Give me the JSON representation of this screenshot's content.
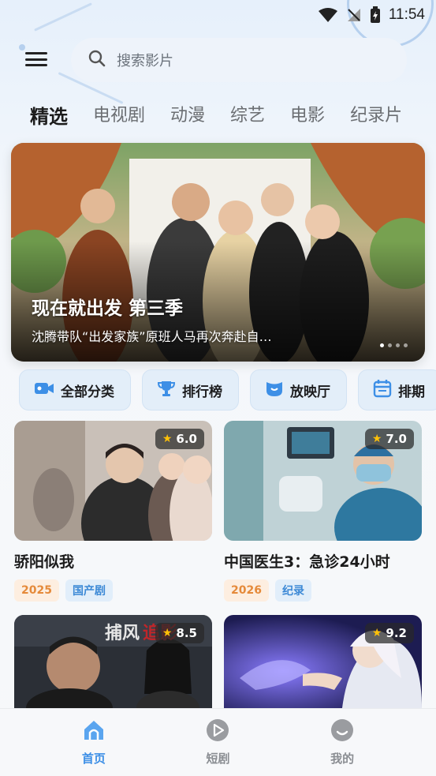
{
  "status_bar": {
    "time": "11:54"
  },
  "search": {
    "placeholder": "搜索影片"
  },
  "tabs": [
    {
      "label": "精选",
      "active": true
    },
    {
      "label": "电视剧",
      "active": false
    },
    {
      "label": "动漫",
      "active": false
    },
    {
      "label": "综艺",
      "active": false
    },
    {
      "label": "电影",
      "active": false
    },
    {
      "label": "纪录片",
      "active": false
    }
  ],
  "banner": {
    "title": "现在就出发 第三季",
    "subtitle": "沈腾带队“出发家族”原班人马再次奔赴自…"
  },
  "quick_actions": [
    {
      "label": "全部分类",
      "icon": "video-camera-icon"
    },
    {
      "label": "排行榜",
      "icon": "trophy-icon"
    },
    {
      "label": "放映厅",
      "icon": "theater-icon"
    },
    {
      "label": "排期",
      "icon": "calendar-icon"
    }
  ],
  "cards": [
    {
      "title": "骄阳似我",
      "rating": "6.0",
      "year": "2025",
      "genre": "国产剧"
    },
    {
      "title": "中国医生3：急诊24小时",
      "rating": "7.0",
      "year": "2026",
      "genre": "纪录"
    },
    {
      "title": "",
      "rating": "8.5",
      "year": "",
      "genre": ""
    },
    {
      "title": "",
      "rating": "9.2",
      "year": "",
      "genre": ""
    }
  ],
  "bottom_nav": [
    {
      "label": "首页",
      "icon": "home-icon",
      "active": true
    },
    {
      "label": "短剧",
      "icon": "play-circle-icon",
      "active": false
    },
    {
      "label": "我的",
      "icon": "smile-icon",
      "active": false
    }
  ],
  "colors": {
    "accent": "#3d8fe6",
    "year_tag": "#e58a3a",
    "genre_tag": "#3c89d6",
    "star": "#ffc107"
  }
}
